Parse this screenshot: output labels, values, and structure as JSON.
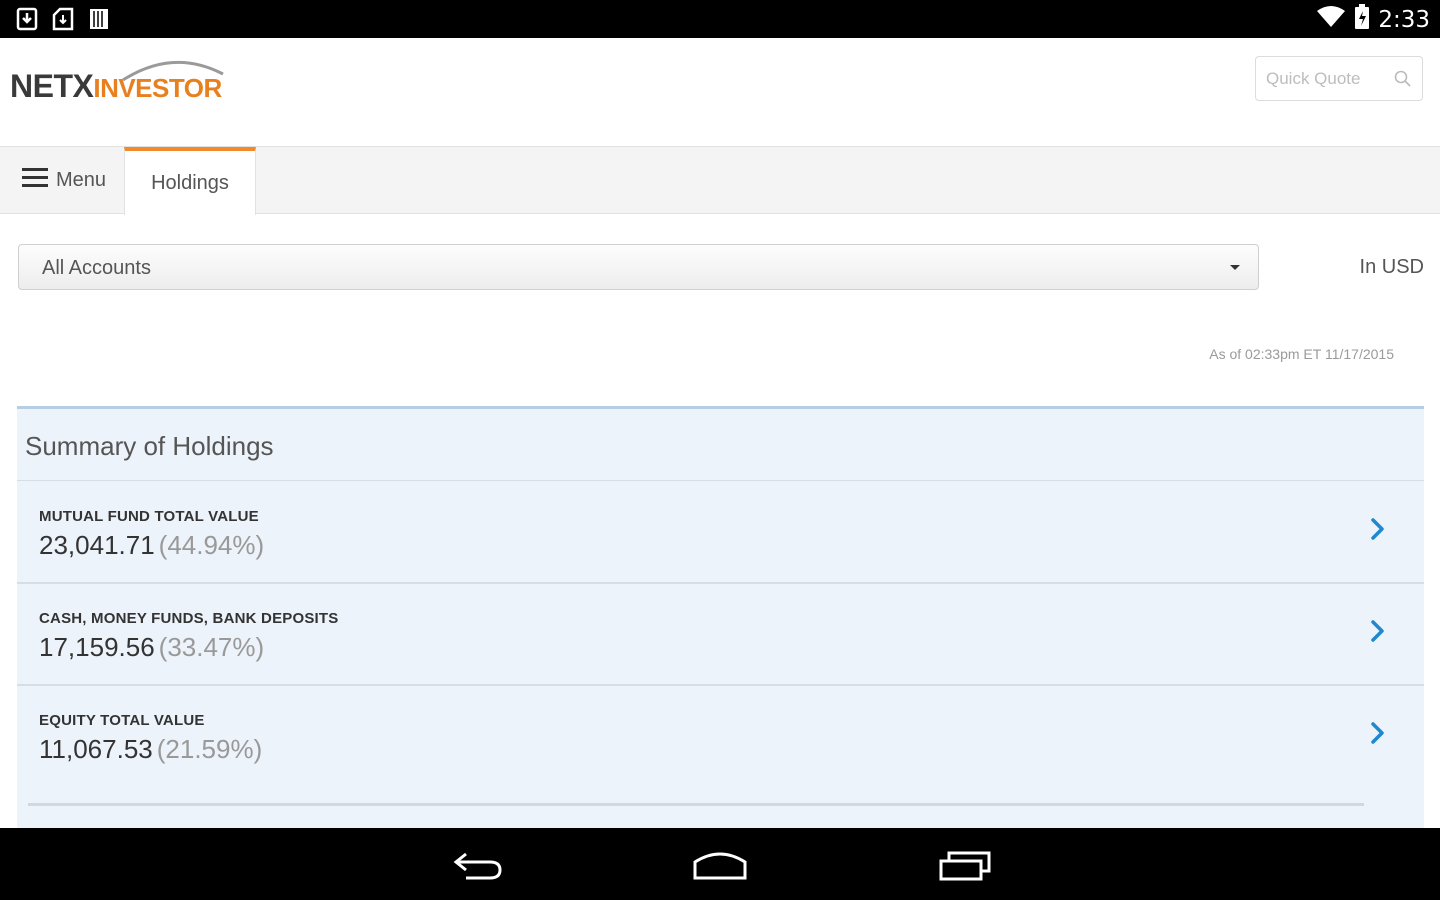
{
  "status_bar": {
    "time": "2:33",
    "left_icons": [
      "download-notification-icon",
      "sd-card-icon",
      "barcode-icon"
    ],
    "right_icons": [
      "wifi-icon",
      "battery-icon"
    ]
  },
  "header": {
    "logo": {
      "part1": "NETX",
      "part2": "INVESTOR"
    },
    "quick_quote": {
      "placeholder": "Quick Quote",
      "value": ""
    }
  },
  "tabs": {
    "menu_label": "Menu",
    "active_tab_label": "Holdings"
  },
  "account_select": {
    "selected": "All Accounts"
  },
  "currency_label": "In USD",
  "as_of": "As of  02:33pm ET 11/17/2015",
  "summary": {
    "title": "Summary of Holdings",
    "rows": [
      {
        "label": "MUTUAL FUND TOTAL VALUE",
        "amount": "23,041.71",
        "pct": "(44.94%)"
      },
      {
        "label": "CASH, MONEY FUNDS, BANK DEPOSITS",
        "amount": "17,159.56",
        "pct": "(33.47%)"
      },
      {
        "label": "EQUITY TOTAL VALUE",
        "amount": "11,067.53",
        "pct": "(21.59%)"
      }
    ]
  },
  "colors": {
    "accent_orange": "#f08a2b",
    "chevron_blue": "#1e88d0",
    "summary_bg": "#edf3fa"
  }
}
